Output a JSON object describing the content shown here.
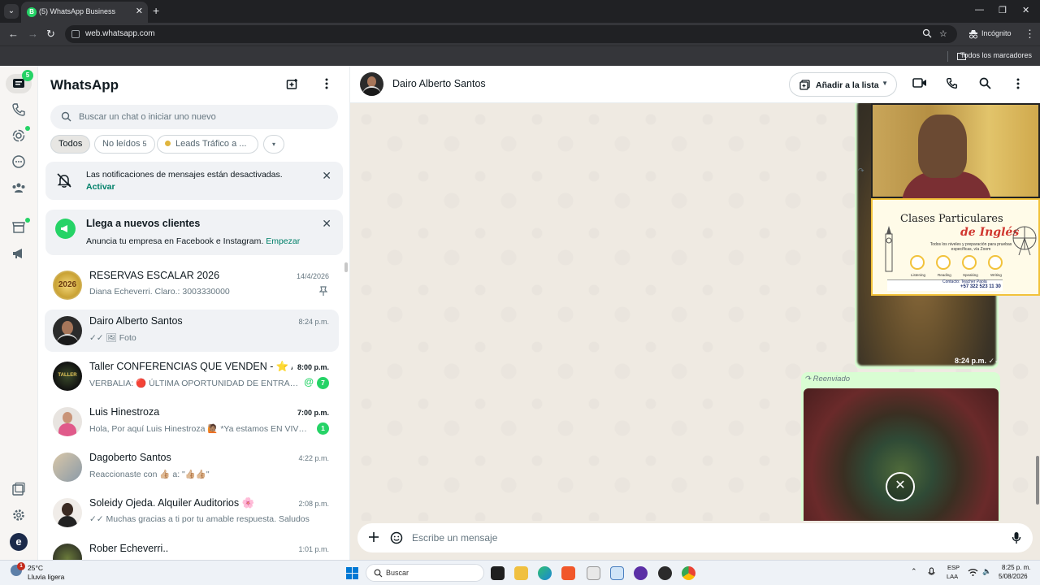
{
  "browser": {
    "tab_title": "(5) WhatsApp Business",
    "url": "web.whatsapp.com",
    "incognito_label": "Incógnito",
    "bookmarks_label": "Todos los marcadores"
  },
  "rail": {
    "chats_badge": "5",
    "accent_color": "#25d366"
  },
  "sidebar": {
    "title": "WhatsApp",
    "search_placeholder": "Buscar un chat o iniciar uno nuevo",
    "filters": {
      "all": "Todos",
      "unread": "No leídos",
      "unread_count": "5",
      "leads": "Leads Tráfico a ..."
    },
    "notice_notifications": {
      "text": "Las notificaciones de mensajes están desactivadas.",
      "link": "Activar"
    },
    "notice_ads": {
      "title": "Llega a nuevos clientes",
      "text": "Anuncia tu empresa en Facebook e Instagram.",
      "link": "Empezar"
    },
    "chats": [
      {
        "name": "RESERVAS ESCALAR 2026",
        "time": "14/4/2026",
        "preview": "Diana Echeverri. Claro.: 3003330000"
      },
      {
        "name": "Dairo Alberto Santos",
        "time": "8:24 p.m.",
        "preview": "✓✓ 🖼 Foto"
      },
      {
        "name": "Taller CONFERENCIAS QUE VENDEN - ⭐ Acce...",
        "time": "8:00 p.m.",
        "preview": "VERBALIA: 🔴 ÚLTIMA OPORTUNIDAD DE ENTRAR!! E...",
        "unread": "7"
      },
      {
        "name": "Luis Hinestroza",
        "time": "7:00 p.m.",
        "preview": "Hola, Por aquí Luis Hinestroza 🙋🏽 *Ya estamos EN VIVO e...",
        "unread": "1"
      },
      {
        "name": "Dagoberto Santos",
        "time": "4:22 p.m.",
        "preview": "Reaccionaste con 👍🏼 a: \"👍🏼👍🏼\""
      },
      {
        "name": "Soleidy Ojeda. Alquiler Auditorios 🌸",
        "time": "2:08 p.m.",
        "preview": "✓✓ Muchas gracias a ti por tu amable respuesta. Saludos"
      },
      {
        "name": "Rober Echeverri..",
        "time": "1:01 p.m.",
        "preview": ""
      }
    ]
  },
  "conversation": {
    "contact_name": "Dairo Alberto Santos",
    "add_to_list": "Añadir a la lista",
    "image_time": "8:24 p.m.",
    "forwarded_label": "Reenviado",
    "composer_placeholder": "Escribe un mensaje",
    "ad_overlay": {
      "title": "Clases Particulares",
      "subtitle": "de Inglés",
      "tagline": "Todos los niveles y preparación para pruebas específicas, vía Zoom",
      "skills": [
        "Listening",
        "Reading",
        "Speaking",
        "Writing"
      ],
      "contact": "Contacto: Teacher Paola",
      "phone": "+57 322 523 11 30"
    }
  },
  "taskbar": {
    "temperature": "25°C",
    "weather": "Lluvia ligera",
    "weather_badge": "1",
    "search_label": "Buscar",
    "lang1": "ESP",
    "lang2": "LAA",
    "time": "8:25 p. m.",
    "date": "5/08/2026"
  }
}
